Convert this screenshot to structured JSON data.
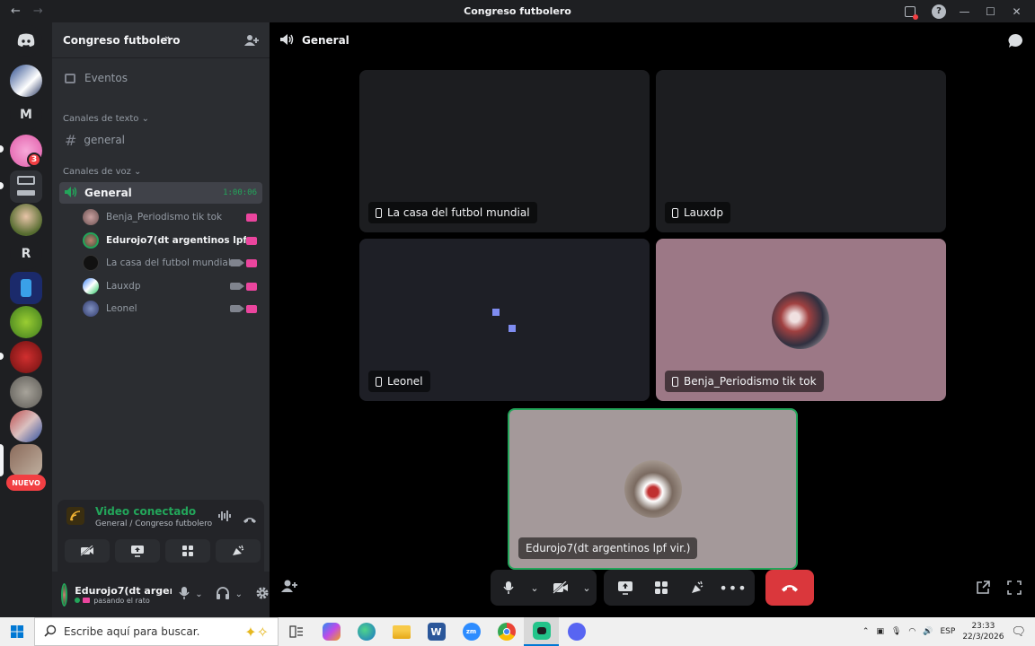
{
  "window": {
    "title": "Congreso futbolero"
  },
  "rail": {
    "letters": [
      "M",
      "R"
    ],
    "mention_badge": "3",
    "new_label": "NUEVO"
  },
  "guild": {
    "name": "Congreso futbolero",
    "events_label": "Eventos",
    "text_category": "Canales de texto",
    "text_channel": "general",
    "voice_category": "Canales de voz",
    "voice_channel": "General",
    "voice_timer": "1:00:06",
    "voice_users": [
      {
        "name": "Benja_Periodismo tik tok"
      },
      {
        "name": "Edurojo7(dt argentinos lpf vir.)"
      },
      {
        "name": "La casa del futbol mundial"
      },
      {
        "name": "Lauxdp"
      },
      {
        "name": "Leonel"
      }
    ]
  },
  "voice_panel": {
    "status": "Video conectado",
    "location": "General / Congreso futbolero"
  },
  "user_panel": {
    "name": "Edurojo7(dt argen...",
    "status": "pasando el rato"
  },
  "stage": {
    "channel_name": "General",
    "tiles": [
      {
        "label": "La casa del futbol mundial"
      },
      {
        "label": "Lauxdp"
      },
      {
        "label": "Leonel"
      },
      {
        "label": "Benja_Periodismo tik tok"
      },
      {
        "label": "Edurojo7(dt argentinos lpf vir.)"
      }
    ]
  },
  "taskbar": {
    "search_placeholder": "Escribe aquí para buscar.",
    "lang": "ESP",
    "time": "23:33",
    "date": "22/3/2026"
  },
  "colors": {
    "accent_green": "#23a55a",
    "hangup_red": "#da373c",
    "live_pink": "#eb459e",
    "blurple": "#5865f2"
  }
}
